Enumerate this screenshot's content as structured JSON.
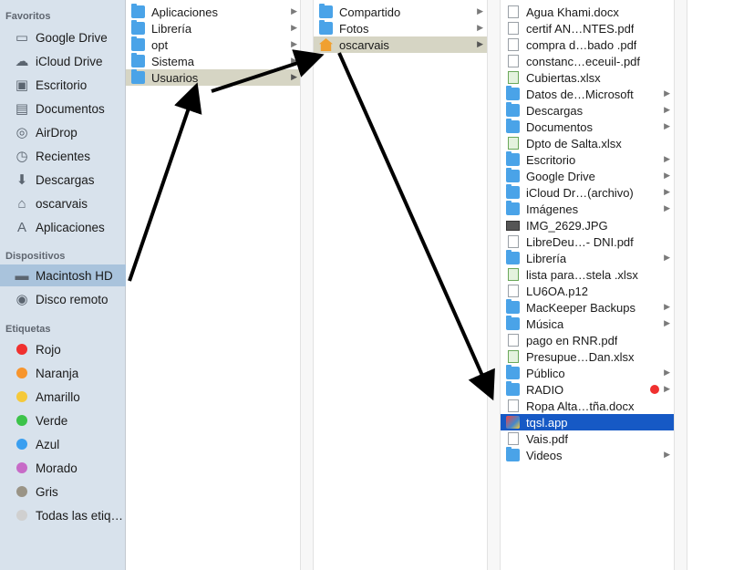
{
  "sidebar": {
    "favoritos_header": "Favoritos",
    "favoritos": [
      {
        "label": "Google Drive",
        "icon": "folder-icon"
      },
      {
        "label": "iCloud Drive",
        "icon": "cloud-icon"
      },
      {
        "label": "Escritorio",
        "icon": "desktop-icon"
      },
      {
        "label": "Documentos",
        "icon": "document-icon"
      },
      {
        "label": "AirDrop",
        "icon": "airdrop-icon"
      },
      {
        "label": "Recientes",
        "icon": "clock-icon"
      },
      {
        "label": "Descargas",
        "icon": "download-icon"
      },
      {
        "label": "oscarvais",
        "icon": "home-icon"
      },
      {
        "label": "Aplicaciones",
        "icon": "applications-icon"
      }
    ],
    "dispositivos_header": "Dispositivos",
    "dispositivos": [
      {
        "label": "Macintosh HD",
        "icon": "hard-drive-icon",
        "selected": true
      },
      {
        "label": "Disco remoto",
        "icon": "disc-icon"
      }
    ],
    "etiquetas_header": "Etiquetas",
    "etiquetas": [
      {
        "label": "Rojo",
        "color": "#f0302f"
      },
      {
        "label": "Naranja",
        "color": "#f7952d"
      },
      {
        "label": "Amarillo",
        "color": "#f5c93a"
      },
      {
        "label": "Verde",
        "color": "#3cc34a"
      },
      {
        "label": "Azul",
        "color": "#3a9ff0"
      },
      {
        "label": "Morado",
        "color": "#c76bc7"
      },
      {
        "label": "Gris",
        "color": "#9a9486"
      },
      {
        "label": "Todas las etiq…",
        "color": "#d0d0d0"
      }
    ]
  },
  "column1": [
    {
      "label": "Aplicaciones",
      "icon": "applications-folder-icon"
    },
    {
      "label": "Librería",
      "icon": "folder-icon"
    },
    {
      "label": "opt",
      "icon": "folder-icon"
    },
    {
      "label": "Sistema",
      "icon": "system-folder-icon"
    },
    {
      "label": "Usuarios",
      "icon": "users-folder-icon",
      "path": true
    }
  ],
  "column2": [
    {
      "label": "Compartido",
      "icon": "folder-icon"
    },
    {
      "label": "Fotos",
      "icon": "folder-icon"
    },
    {
      "label": "oscarvais",
      "icon": "home-icon",
      "path": true
    }
  ],
  "column3": [
    {
      "label": "Agua Khami.docx",
      "icon": "doc-icon",
      "folder": false
    },
    {
      "label": "certif AN…NTES.pdf",
      "icon": "pdf-icon",
      "folder": false
    },
    {
      "label": "compra d…bado .pdf",
      "icon": "pdf-icon",
      "folder": false
    },
    {
      "label": "constanc…eceuil-.pdf",
      "icon": "pdf-icon",
      "folder": false
    },
    {
      "label": "Cubiertas.xlsx",
      "icon": "sheet-icon",
      "folder": false
    },
    {
      "label": "Datos de…Microsoft",
      "icon": "folder-icon",
      "folder": true
    },
    {
      "label": "Descargas",
      "icon": "folder-icon",
      "folder": true
    },
    {
      "label": "Documentos",
      "icon": "folder-icon",
      "folder": true
    },
    {
      "label": "Dpto de Salta.xlsx",
      "icon": "sheet-icon",
      "folder": false
    },
    {
      "label": "Escritorio",
      "icon": "folder-icon",
      "folder": true
    },
    {
      "label": "Google Drive",
      "icon": "folder-icon",
      "folder": true
    },
    {
      "label": "iCloud Dr…(archivo)",
      "icon": "folder-icon",
      "folder": true
    },
    {
      "label": "Imágenes",
      "icon": "folder-icon",
      "folder": true
    },
    {
      "label": "IMG_2629.JPG",
      "icon": "image-icon",
      "folder": false
    },
    {
      "label": "LibreDeu…- DNI.pdf",
      "icon": "pdf-icon",
      "folder": false
    },
    {
      "label": "Librería",
      "icon": "folder-icon",
      "folder": true
    },
    {
      "label": "lista para…stela .xlsx",
      "icon": "sheet-icon",
      "folder": false
    },
    {
      "label": "LU6OA.p12",
      "icon": "doc-icon",
      "folder": false
    },
    {
      "label": "MacKeeper Backups",
      "icon": "folder-icon",
      "folder": true
    },
    {
      "label": "Música",
      "icon": "folder-icon",
      "folder": true
    },
    {
      "label": "pago en RNR.pdf",
      "icon": "pdf-icon",
      "folder": false
    },
    {
      "label": "Presupue…Dan.xlsx",
      "icon": "sheet-icon",
      "folder": false
    },
    {
      "label": "Público",
      "icon": "folder-icon",
      "folder": true
    },
    {
      "label": "RADIO",
      "icon": "folder-icon",
      "folder": true,
      "tag": "#f0302f"
    },
    {
      "label": "Ropa Alta…tña.docx",
      "icon": "doc-icon",
      "folder": false
    },
    {
      "label": "tqsl.app",
      "icon": "app-icon",
      "folder": false,
      "active": true
    },
    {
      "label": "Vais.pdf",
      "icon": "pdf-icon",
      "folder": false
    },
    {
      "label": "Videos",
      "icon": "folder-icon",
      "folder": true
    }
  ]
}
